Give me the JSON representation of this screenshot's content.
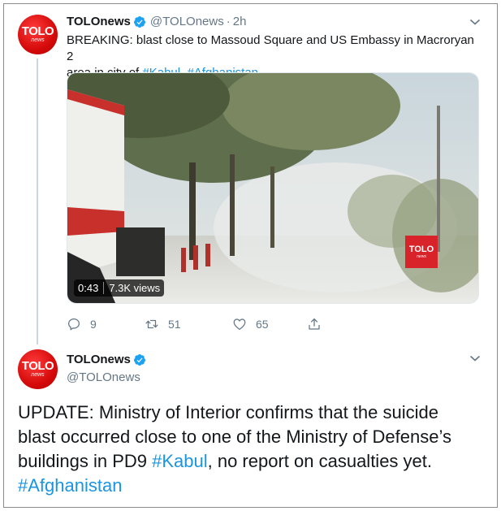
{
  "colors": {
    "link": "#1b95e0",
    "brand": "#d50a0a",
    "muted": "#657786"
  },
  "tweet1": {
    "avatar": {
      "big": "TOLO",
      "small": "news"
    },
    "name": "TOLOnews",
    "handle": "@TOLOnews",
    "separator": "·",
    "time": "2h",
    "text_line1": "BREAKING: blast close to Massoud Square and US Embassy in Macroryan 2",
    "text_line2_prefix": "area in city of ",
    "hashtag1": "#Kabul",
    "dot_space": ". ",
    "hashtag2": "#Afghanistan",
    "video": {
      "duration": "0:43",
      "views": "7.3K views",
      "watermark_big": "TOLO",
      "watermark_small": "news"
    },
    "actions": {
      "replies": "9",
      "retweets": "51",
      "likes": "65"
    }
  },
  "tweet2": {
    "avatar": {
      "big": "TOLO",
      "small": "news"
    },
    "name": "TOLOnews",
    "handle": "@TOLOnews",
    "line1": "UPDATE: Ministry of Interior confirms that the suicide",
    "line2": "blast occurred close to one of the Ministry of Defense’s",
    "line3_prefix": "buildings in PD9 ",
    "hashtag1": "#Kabul",
    "line3_suffix": ", no report on casualties yet.",
    "hashtag2": "#Afghanistan"
  }
}
